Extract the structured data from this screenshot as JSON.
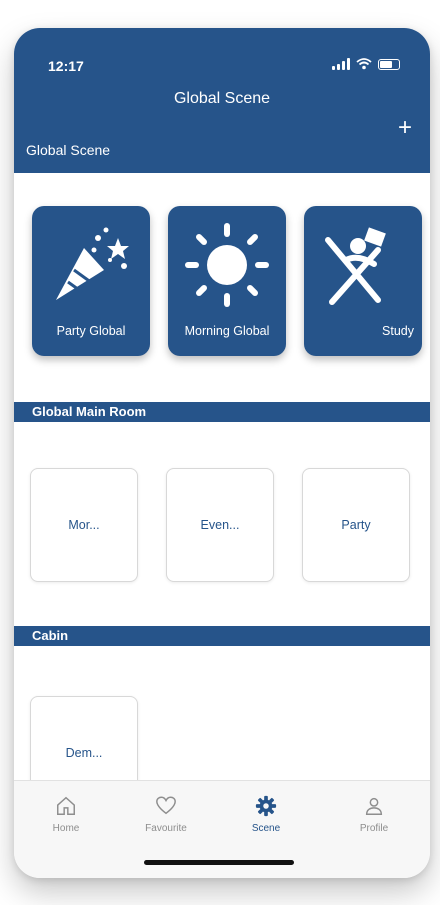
{
  "status": {
    "time": "12:17"
  },
  "header": {
    "title": "Global Scene",
    "section_label": "Global Scene"
  },
  "global_scenes": [
    {
      "label": "Party Global",
      "icon": "party-popper-icon"
    },
    {
      "label": "Morning Global",
      "icon": "sun-icon"
    },
    {
      "label": "Study",
      "icon": "reading-chair-icon"
    }
  ],
  "groups": [
    {
      "title": "Global Main Room",
      "items": [
        "Mor...",
        "Even...",
        "Party"
      ]
    },
    {
      "title": "Cabin",
      "items": [
        "Dem..."
      ]
    }
  ],
  "tabs": [
    {
      "label": "Home",
      "icon": "home-icon",
      "active": false
    },
    {
      "label": "Favourite",
      "icon": "heart-icon",
      "active": false
    },
    {
      "label": "Scene",
      "icon": "gear-icon",
      "active": true
    },
    {
      "label": "Profile",
      "icon": "person-icon",
      "active": false
    }
  ],
  "colors": {
    "primary": "#26548a",
    "tab_inactive": "#8e8e8e"
  }
}
